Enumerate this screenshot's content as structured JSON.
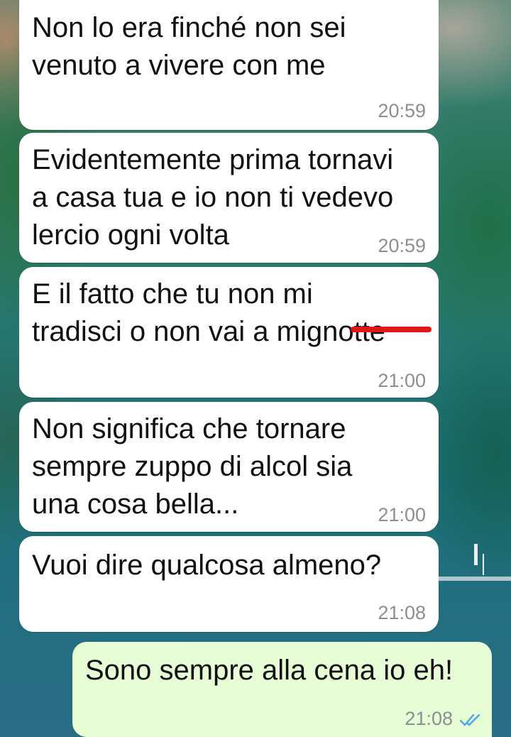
{
  "chat": {
    "messages": [
      {
        "direction": "incoming",
        "text": "Non lo era finché non sei\nvenuto a vivere con me",
        "time": "20:59"
      },
      {
        "direction": "incoming",
        "text": "Evidentemente prima tornavi\na casa tua e io non ti vedevo\nlercio ogni volta",
        "time": "20:59"
      },
      {
        "direction": "incoming",
        "text": "E il fatto che tu non mi\ntradisci o non vai a mignotte",
        "time": "21:00",
        "annotation": "red line over last word"
      },
      {
        "direction": "incoming",
        "text": "Non significa che tornare\nsempre zuppo di alcol sia\nuna cosa bella...",
        "time": "21:00"
      },
      {
        "direction": "incoming",
        "text": "Vuoi dire qualcosa almeno?",
        "time": "21:08"
      },
      {
        "direction": "outgoing",
        "text": "Sono sempre alla cena io eh!",
        "time": "21:08",
        "status": "read-double-check-icon"
      }
    ]
  },
  "colors": {
    "incoming_bubble": "#ffffff",
    "outgoing_bubble": "#e7fdd6",
    "timestamp": "#8a8f93",
    "read_ticks": "#4fa6e6",
    "scribble": "#e0161b"
  }
}
